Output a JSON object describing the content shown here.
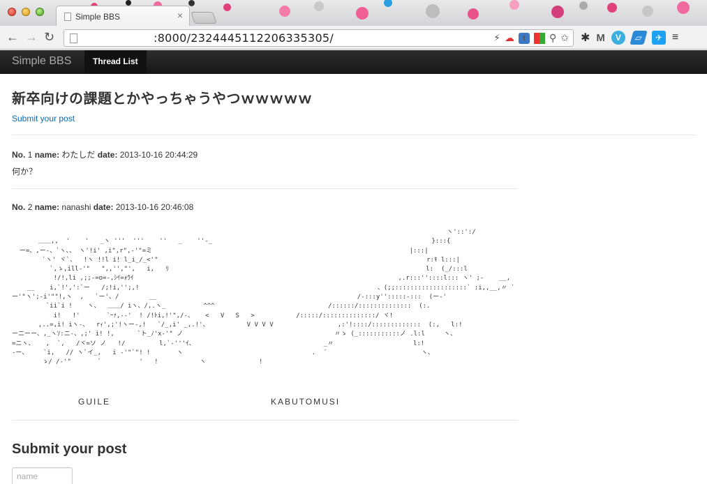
{
  "browser": {
    "tab_title": "Simple BBS",
    "tab_close": "×",
    "url": ":8000/2324445112206335305/",
    "nav": {
      "back": "←",
      "forward": "→",
      "reload": "↻"
    },
    "omnibox_icons": [
      "⚡",
      "☁",
      "✩"
    ],
    "extensions": [
      {
        "label": "t",
        "color": "#3c79c4",
        "name": "tumblr-extension-icon"
      },
      {
        "label": "■",
        "color": "#e1a325",
        "name": "color-picker-extension-icon"
      },
      {
        "label": "🔍",
        "color": "#ffffff",
        "name": "zoom-extension-icon"
      }
    ],
    "toolbar_icons": [
      "✱",
      "M",
      "V",
      "▱",
      "🐦",
      "≡"
    ]
  },
  "site": {
    "brand": "Simple BBS",
    "nav_active": "Thread List"
  },
  "thread": {
    "title": "新卒向けの課題とかやっちゃうやつｗｗｗｗｗ",
    "submit_link": "Submit your post"
  },
  "posts": [
    {
      "no_label": "No.",
      "no": "1",
      "name_label": "name:",
      "name": "わたしだ",
      "date_label": "date:",
      "date": "2013-10-16 20:44:29",
      "body": "何か？"
    },
    {
      "no_label": "No.",
      "no": "2",
      "name_label": "name:",
      "name": "nanashi",
      "date_label": "date:",
      "date": "2013-10-16 20:46:08",
      "ascii_art": "                                                                                                                   ヽ'::':/\n       ＿＿,,  '    '   _ヽ '''  '''    ''   _    ''-_                                                          }:::{\n  ー=、,ー-、`ヽ、、 ヽ'!i' ,i\",r\",-'\"=ミ                                                                    |:::|\n        `ヽ' ヾ`、  !ヽ !!l i! l_i_/_<'\"                                                                       r:ｷ l:::|\n          `,ゝ,ill-'\"   \",,'',\"',   i,   ﾘ                                                                    l:  (_/:::l\n           !/!,li ,;;-=o=-,ｼｲ=ｫｳｲ                                                                      ,.r:::''::::l::: ヽ' ;-    __,\n    __    i,`!',':`ー   /;!i,'';,!                                                               、(;;:::::::::::::::::::` :i,,__,〃 `\nー'\"ヽ';-i'\"\"!,ヽ  ,   `ー'、/        __                                                     /-:::y'':::::-:::  (ー-'\n         `ii`i !    ヽ、  ＿＿/ iヽ、/,.ヽ_          ^^^                              /::::::/::::::::::::::  (:.\n           i!   !'       `ｰｧ,--'  ! /!ﾄi,!'\",/-、   <   V   S   >           /:::::/::::::::::::::/ ヾ!\n       ,..=,i! iヽ-、  rｨ',;'!ヽー-,!   `/_,i' _,.!'、          V V V V                 ,:'!::::/:::::::::::::  (:,   l:!\nーニーー、,_ヽｿ:ニ-、,;' i! !,      `ト_ﾉ'x-'\" ノ                                        〃ゝ (_:::::::::::ノ .l:l     ヽ、\n=ニヽ、   ,  `,   /ヾ=ソ ノ   !/         l,`-'''ｲ、                                  _〃                     l:!\n-ー、    `i,   // ヽ`イ_,   i -'\"`\"! !       ヽ                                  .  ´                         ヽ、\n        ゝ/ /-'\"       `          '   !           ヽ              !"
    }
  ],
  "ascii_captions": [
    "GUILE",
    "KABUTOMUSI"
  ],
  "form": {
    "title": "Submit your post",
    "name_placeholder": "name"
  }
}
